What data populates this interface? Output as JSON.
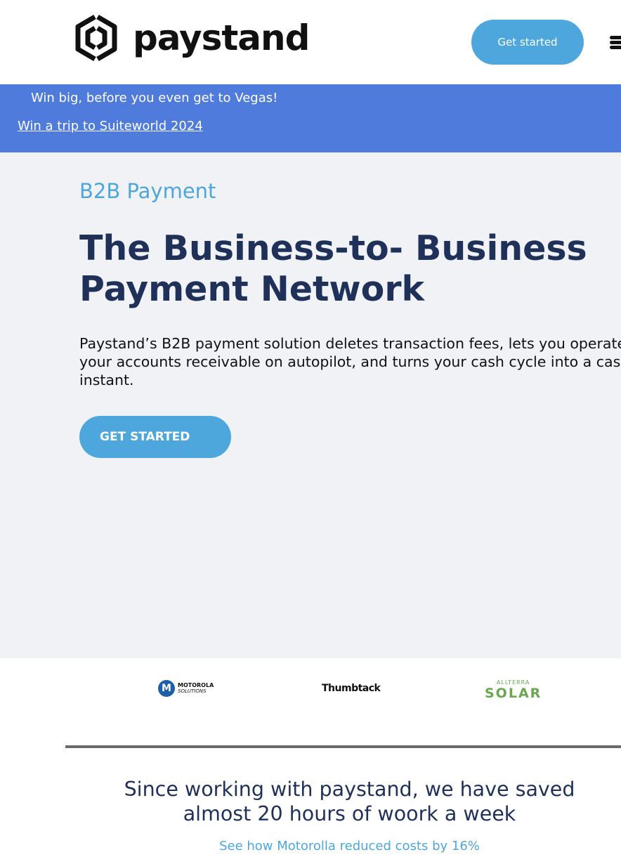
{
  "header": {
    "logo_text": "paystand",
    "cta_label": "Get started",
    "menu_icon": "hamburger-menu-icon"
  },
  "banner": {
    "text": "Win big, before you even get to Vegas!",
    "link": "Win a trip to Suiteworld 2024"
  },
  "hero": {
    "eyebrow": "B2B Payment",
    "headline": "The Business-to- Business Payment Network",
    "body_lines": [
      "Paystand’s B2B payment solution deletes transaction fees, lets you operate",
      "your accounts receivable on autopilot, and turns your cash cycle into a cash",
      "instant."
    ],
    "cta_label": "GET STARTED"
  },
  "logos": {
    "motorola": {
      "mark": "M",
      "line1": "MOTOROLA",
      "line2": "SOLUTIONS"
    },
    "thumbtack": "Thumbtack",
    "allterra": {
      "line1": "ALLTERRA",
      "line2": "SOLAR"
    }
  },
  "testimonial": {
    "quote_lines": [
      "Since working with paystand, we have saved",
      "almost 20 hours of woork a week"
    ],
    "link": "See how Motorolla reduced costs by 16%"
  },
  "colors": {
    "accent": "#4ea7dc",
    "banner": "#4e7bdc",
    "heading": "#1f3158",
    "hero_bg": "#f0f2f6"
  }
}
